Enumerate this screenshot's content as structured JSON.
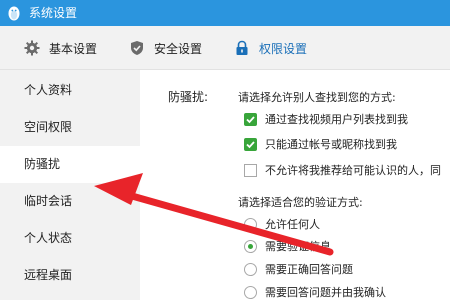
{
  "window": {
    "title": "系统设置"
  },
  "tabs": [
    {
      "label": "基本设置",
      "icon": "gear-icon"
    },
    {
      "label": "安全设置",
      "icon": "shield-icon"
    },
    {
      "label": "权限设置",
      "icon": "lock-icon"
    }
  ],
  "active_tab": "权限设置",
  "sidebar": {
    "items": [
      {
        "label": "个人资料"
      },
      {
        "label": "空间权限"
      },
      {
        "label": "防骚扰"
      },
      {
        "label": "临时会话"
      },
      {
        "label": "个人状态"
      },
      {
        "label": "远程桌面"
      }
    ],
    "active": "防骚扰"
  },
  "main": {
    "section_label": "防骚扰:",
    "find_prompt": "请选择允许别人查找到您的方式:",
    "find_options": [
      {
        "label": "通过查找视频用户列表找到我",
        "checked": true
      },
      {
        "label": "只能通过帐号或昵称找到我",
        "checked": true
      },
      {
        "label": "不允许将我推荐给可能认识的人，同",
        "checked": false
      }
    ],
    "verify_prompt": "请选择适合您的验证方式:",
    "verify_options": [
      {
        "label": "允许任何人",
        "selected": false
      },
      {
        "label": "需要验证信息",
        "selected": true
      },
      {
        "label": "需要正确回答问题",
        "selected": false
      },
      {
        "label": "需要回答问题并由我确认",
        "selected": false
      }
    ]
  },
  "colors": {
    "titlebar": "#2b95de",
    "accent": "#1a6fb8",
    "check": "#38a53a",
    "annotation": "#e8242a"
  }
}
